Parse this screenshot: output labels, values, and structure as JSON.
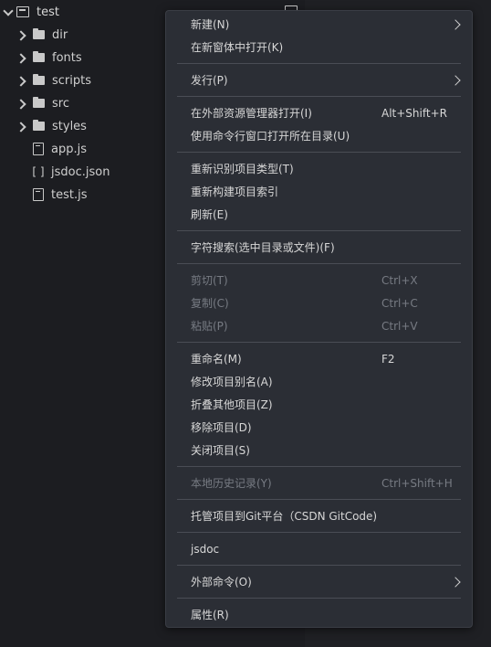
{
  "tree": {
    "project_name": "test",
    "folders": [
      {
        "label": "dir"
      },
      {
        "label": "fonts"
      },
      {
        "label": "scripts"
      },
      {
        "label": "src"
      },
      {
        "label": "styles"
      }
    ],
    "files": [
      {
        "label": "app.js",
        "icon": "file-icon"
      },
      {
        "label": "jsdoc.json",
        "icon": "json-icon"
      },
      {
        "label": "test.js",
        "icon": "file-icon"
      }
    ],
    "json_icon_text": "[ ]"
  },
  "menu": {
    "items": [
      {
        "label": "新建(N)",
        "shortcut": "",
        "submenu": true,
        "disabled": false
      },
      {
        "label": "在新窗体中打开(K)",
        "shortcut": "",
        "submenu": false,
        "disabled": false
      },
      {
        "label": "发行(P)",
        "shortcut": "",
        "submenu": true,
        "disabled": false
      },
      {
        "label": "在外部资源管理器打开(I)",
        "shortcut": "Alt+Shift+R",
        "submenu": false,
        "disabled": false
      },
      {
        "label": "使用命令行窗口打开所在目录(U)",
        "shortcut": "",
        "submenu": false,
        "disabled": false
      },
      {
        "label": "重新识别项目类型(T)",
        "shortcut": "",
        "submenu": false,
        "disabled": false
      },
      {
        "label": "重新构建项目索引",
        "shortcut": "",
        "submenu": false,
        "disabled": false
      },
      {
        "label": "刷新(E)",
        "shortcut": "",
        "submenu": false,
        "disabled": false
      },
      {
        "label": "字符搜索(选中目录或文件)(F)",
        "shortcut": "",
        "submenu": false,
        "disabled": false
      },
      {
        "label": "剪切(T)",
        "shortcut": "Ctrl+X",
        "submenu": false,
        "disabled": true
      },
      {
        "label": "复制(C)",
        "shortcut": "Ctrl+C",
        "submenu": false,
        "disabled": true
      },
      {
        "label": "粘贴(P)",
        "shortcut": "Ctrl+V",
        "submenu": false,
        "disabled": true
      },
      {
        "label": "重命名(M)",
        "shortcut": "F2",
        "submenu": false,
        "disabled": false
      },
      {
        "label": "修改项目别名(A)",
        "shortcut": "",
        "submenu": false,
        "disabled": false
      },
      {
        "label": "折叠其他项目(Z)",
        "shortcut": "",
        "submenu": false,
        "disabled": false
      },
      {
        "label": "移除项目(D)",
        "shortcut": "",
        "submenu": false,
        "disabled": false
      },
      {
        "label": "关闭项目(S)",
        "shortcut": "",
        "submenu": false,
        "disabled": false
      },
      {
        "label": "本地历史记录(Y)",
        "shortcut": "Ctrl+Shift+H",
        "submenu": false,
        "disabled": true
      },
      {
        "label": "托管项目到Git平台（CSDN GitCode)",
        "shortcut": "",
        "submenu": false,
        "disabled": false
      },
      {
        "label": "jsdoc",
        "shortcut": "",
        "submenu": false,
        "disabled": false
      },
      {
        "label": "外部命令(O)",
        "shortcut": "",
        "submenu": true,
        "disabled": false
      },
      {
        "label": "属性(R)",
        "shortcut": "",
        "submenu": false,
        "disabled": false
      }
    ]
  }
}
